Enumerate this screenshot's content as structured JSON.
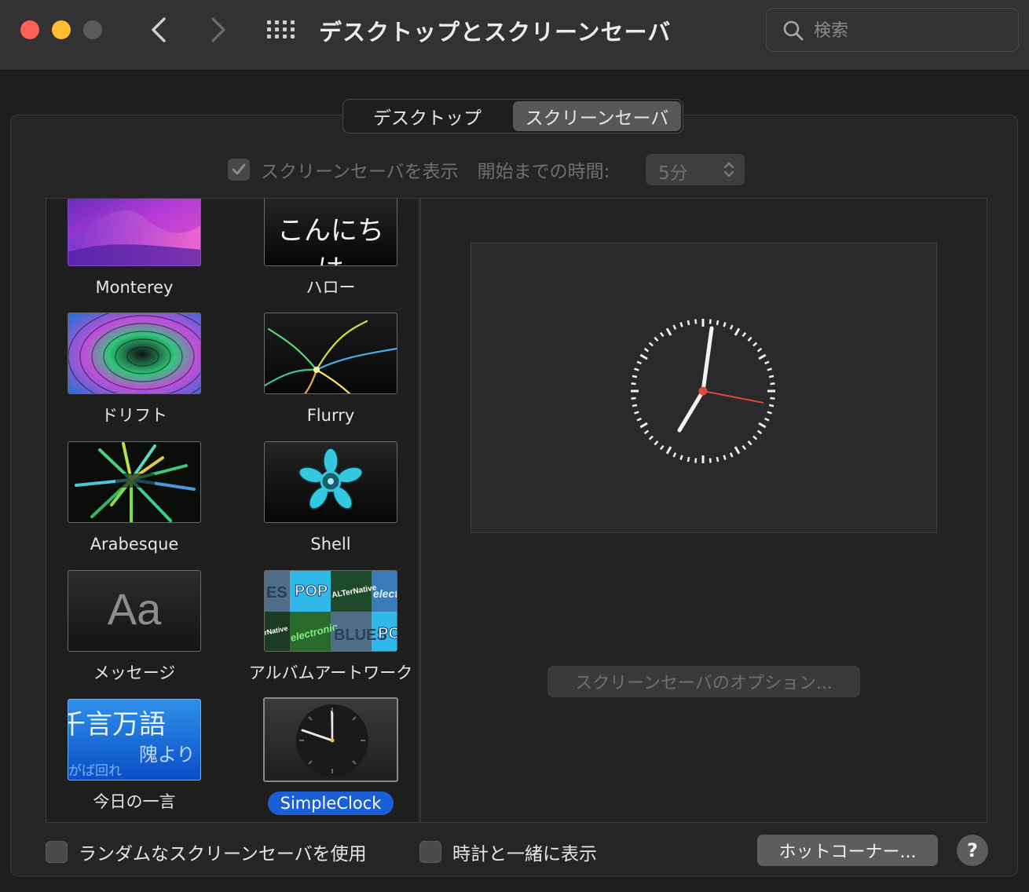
{
  "window": {
    "title": "デスクトップとスクリーンセーバ",
    "search_placeholder": "検索"
  },
  "tabs": [
    {
      "label": "デスクトップ",
      "active": false
    },
    {
      "label": "スクリーンセーバ",
      "active": true
    }
  ],
  "options": {
    "show_screensaver_label": "スクリーンセーバを表示",
    "show_screensaver_checked": true,
    "start_after_label": "開始までの時間:",
    "start_after_value": "5分"
  },
  "savers": [
    {
      "name": "Monterey",
      "thumb": "monterey"
    },
    {
      "name": "ハロー",
      "thumb": "hello",
      "thumb_text": "こんにちは"
    },
    {
      "name": "ドリフト",
      "thumb": "drift"
    },
    {
      "name": "Flurry",
      "thumb": "flurry"
    },
    {
      "name": "Arabesque",
      "thumb": "arabesque"
    },
    {
      "name": "Shell",
      "thumb": "shell"
    },
    {
      "name": "メッセージ",
      "thumb": "message",
      "thumb_text": "Aa"
    },
    {
      "name": "アルバムアートワーク",
      "thumb": "album",
      "thumb_text": [
        "ES",
        "POP",
        "ALTerNative",
        "electr",
        "rNative",
        "electronic",
        "BLUES",
        "PO"
      ]
    },
    {
      "name": "今日の一言",
      "thumb": "word",
      "thumb_text": [
        "千言万語",
        "隗より",
        "がば回れ"
      ]
    },
    {
      "name": "SimpleClock",
      "thumb": "clock",
      "selected": true
    }
  ],
  "preview": {
    "options_button": "スクリーンセーバのオプション..."
  },
  "bottom": {
    "random_label": "ランダムなスクリーンセーバを使用",
    "random_checked": false,
    "clock_label": "時計と一緒に表示",
    "clock_checked": false,
    "hot_corners_button": "ホットコーナー...",
    "help_button": "?"
  },
  "colors": {
    "accent_blue": "#1a5fd6",
    "close": "#fe5f57",
    "minimize": "#febc2e",
    "clock_second_hand": "#e0483a"
  }
}
